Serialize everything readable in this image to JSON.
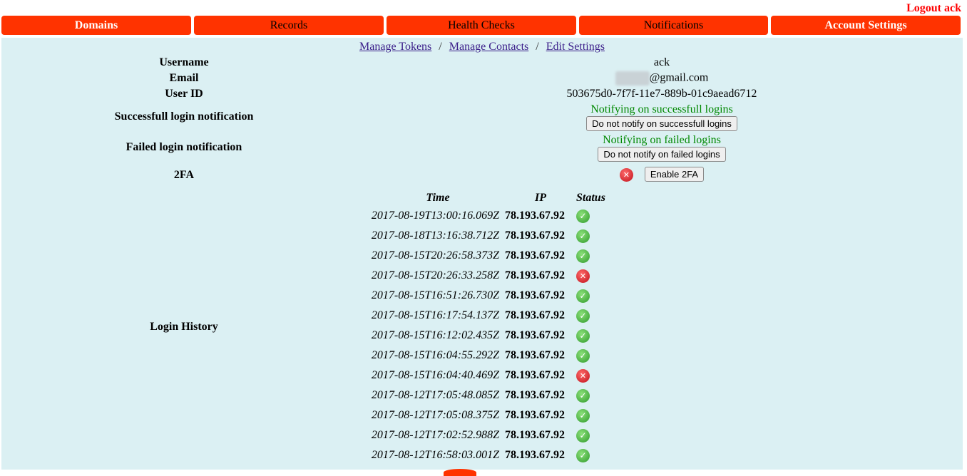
{
  "header": {
    "logout_label": "Logout ack"
  },
  "tabs": [
    {
      "label": "Domains",
      "active": true
    },
    {
      "label": "Records",
      "active": false
    },
    {
      "label": "Health Checks",
      "active": false
    },
    {
      "label": "Notifications",
      "active": false
    },
    {
      "label": "Account Settings",
      "active": true
    }
  ],
  "subnav": {
    "manage_tokens": "Manage Tokens",
    "manage_contacts": "Manage Contacts",
    "edit_settings": "Edit Settings",
    "separator": "/"
  },
  "account": {
    "username_label": "Username",
    "username": "ack",
    "email_label": "Email",
    "email_domain": "@gmail.com",
    "userid_label": "User ID",
    "userid": "503675d0-7f7f-11e7-889b-01c9aead6712",
    "success_label": "Successfull login notification",
    "success_status": "Notifying on successfull logins",
    "success_button": "Do not notify on successfull logins",
    "failed_label": "Failed login notification",
    "failed_status": "Notifying on failed logins",
    "failed_button": "Do not notify on failed logins",
    "twofa_label": "2FA",
    "twofa_button": "Enable 2FA",
    "twofa_enabled": false
  },
  "login_history": {
    "label": "Login History",
    "columns": [
      "Time",
      "IP",
      "Status"
    ],
    "rows": [
      {
        "time": "2017-08-19T13:00:16.069Z",
        "ip": "78.193.67.92",
        "ok": true
      },
      {
        "time": "2017-08-18T13:16:38.712Z",
        "ip": "78.193.67.92",
        "ok": true
      },
      {
        "time": "2017-08-15T20:26:58.373Z",
        "ip": "78.193.67.92",
        "ok": true
      },
      {
        "time": "2017-08-15T20:26:33.258Z",
        "ip": "78.193.67.92",
        "ok": false
      },
      {
        "time": "2017-08-15T16:51:26.730Z",
        "ip": "78.193.67.92",
        "ok": true
      },
      {
        "time": "2017-08-15T16:17:54.137Z",
        "ip": "78.193.67.92",
        "ok": true
      },
      {
        "time": "2017-08-15T16:12:02.435Z",
        "ip": "78.193.67.92",
        "ok": true
      },
      {
        "time": "2017-08-15T16:04:55.292Z",
        "ip": "78.193.67.92",
        "ok": true
      },
      {
        "time": "2017-08-15T16:04:40.469Z",
        "ip": "78.193.67.92",
        "ok": false
      },
      {
        "time": "2017-08-12T17:05:48.085Z",
        "ip": "78.193.67.92",
        "ok": true
      },
      {
        "time": "2017-08-12T17:05:08.375Z",
        "ip": "78.193.67.92",
        "ok": true
      },
      {
        "time": "2017-08-12T17:02:52.988Z",
        "ip": "78.193.67.92",
        "ok": true
      },
      {
        "time": "2017-08-12T16:58:03.001Z",
        "ip": "78.193.67.92",
        "ok": true
      }
    ]
  },
  "icons": {
    "ok": "check-icon",
    "fail": "cross-icon"
  },
  "colors": {
    "tab_bg": "#ff3300",
    "content_bg": "#dbf0f3",
    "logout": "#ff0000",
    "status_green": "#008800"
  }
}
